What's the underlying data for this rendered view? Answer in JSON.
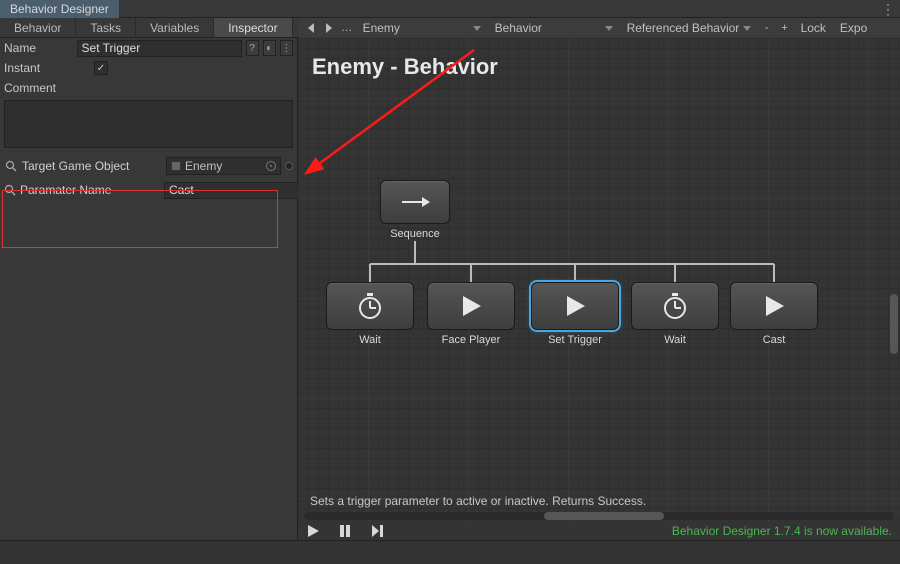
{
  "title": "Behavior Designer",
  "panel_tabs": [
    "Behavior",
    "Tasks",
    "Variables",
    "Inspector"
  ],
  "panel_active_tab": 3,
  "toolbar": {
    "dropdown1": "Enemy",
    "dropdown2": "Behavior",
    "dropdown3": "Referenced Behavior",
    "minus": "-",
    "plus": "+",
    "lock": "Lock",
    "export": "Expo"
  },
  "inspector": {
    "name_label": "Name",
    "name_value": "Set Trigger",
    "instant_label": "Instant",
    "instant_checked": true,
    "comment_label": "Comment",
    "target_label": "Target Game Object",
    "target_value": "Enemy",
    "param_label": "Paramater Name",
    "param_value": "Cast"
  },
  "graph": {
    "title": "Enemy - Behavior",
    "root": "Sequence",
    "children": [
      "Wait",
      "Face Player",
      "Set Trigger",
      "Wait",
      "Cast"
    ],
    "selected_index": 2,
    "description": "Sets a trigger parameter to active or inactive. Returns Success."
  },
  "status_message": "Behavior Designer 1.7.4 is now available."
}
